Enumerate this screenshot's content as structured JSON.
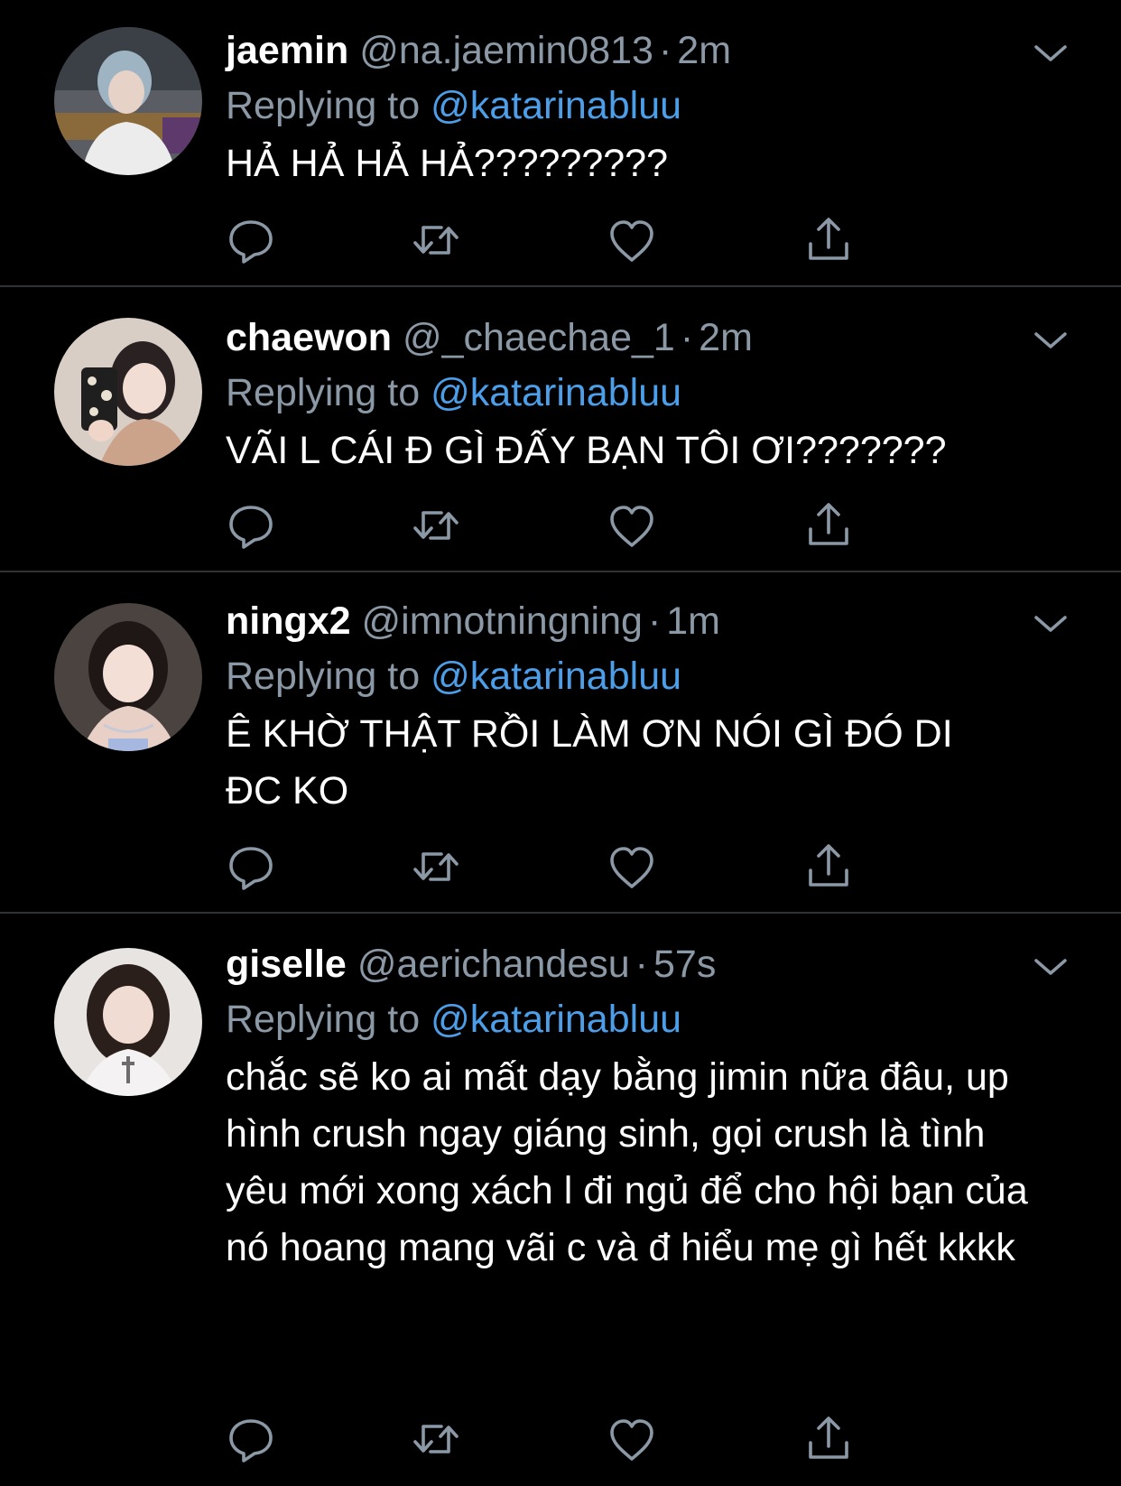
{
  "colors": {
    "background": "#000000",
    "primary_text": "#ffffff",
    "secondary_text": "#8b98a5",
    "link": "#4d9ee8",
    "divider": "#2f3336"
  },
  "tweets": [
    {
      "name": "jaemin",
      "handle": "@na.jaemin0813",
      "dot": "·",
      "time": "2m",
      "reply_prefix": "Replying to",
      "reply_to": "@katarinabluu",
      "text": "HẢ HẢ HẢ HẢ?????????",
      "icons": [
        "reply-icon",
        "retweet-icon",
        "like-icon",
        "share-icon",
        "chevron-down-icon"
      ]
    },
    {
      "name": "chaewon",
      "handle": "@_chaechae_1",
      "dot": "·",
      "time": "2m",
      "reply_prefix": "Replying to",
      "reply_to": "@katarinabluu",
      "text": "VÃI L CÁI Đ GÌ ĐẤY BẠN TÔI ƠI???????",
      "icons": [
        "reply-icon",
        "retweet-icon",
        "like-icon",
        "share-icon",
        "chevron-down-icon"
      ]
    },
    {
      "name": "ningx2",
      "handle": "@imnotningning",
      "dot": "·",
      "time": "1m",
      "reply_prefix": "Replying to",
      "reply_to": "@katarinabluu",
      "text": "Ê KHỜ THẬT RỒI LÀM ƠN NÓI GÌ ĐÓ DI ĐC KO",
      "icons": [
        "reply-icon",
        "retweet-icon",
        "like-icon",
        "share-icon",
        "chevron-down-icon"
      ]
    },
    {
      "name": "giselle",
      "handle": "@aerichandesu",
      "dot": "·",
      "time": "57s",
      "reply_prefix": "Replying to",
      "reply_to": "@katarinabluu",
      "text": "chắc sẽ ko ai mất dạy bằng jimin nữa đâu, up hình crush ngay giáng sinh, gọi crush là tình yêu mới xong xách l đi ngủ để cho hội bạn của nó hoang mang vãi c và đ hiểu mẹ gì hết kkkk",
      "icons": [
        "reply-icon",
        "retweet-icon",
        "like-icon",
        "share-icon",
        "chevron-down-icon"
      ]
    }
  ]
}
